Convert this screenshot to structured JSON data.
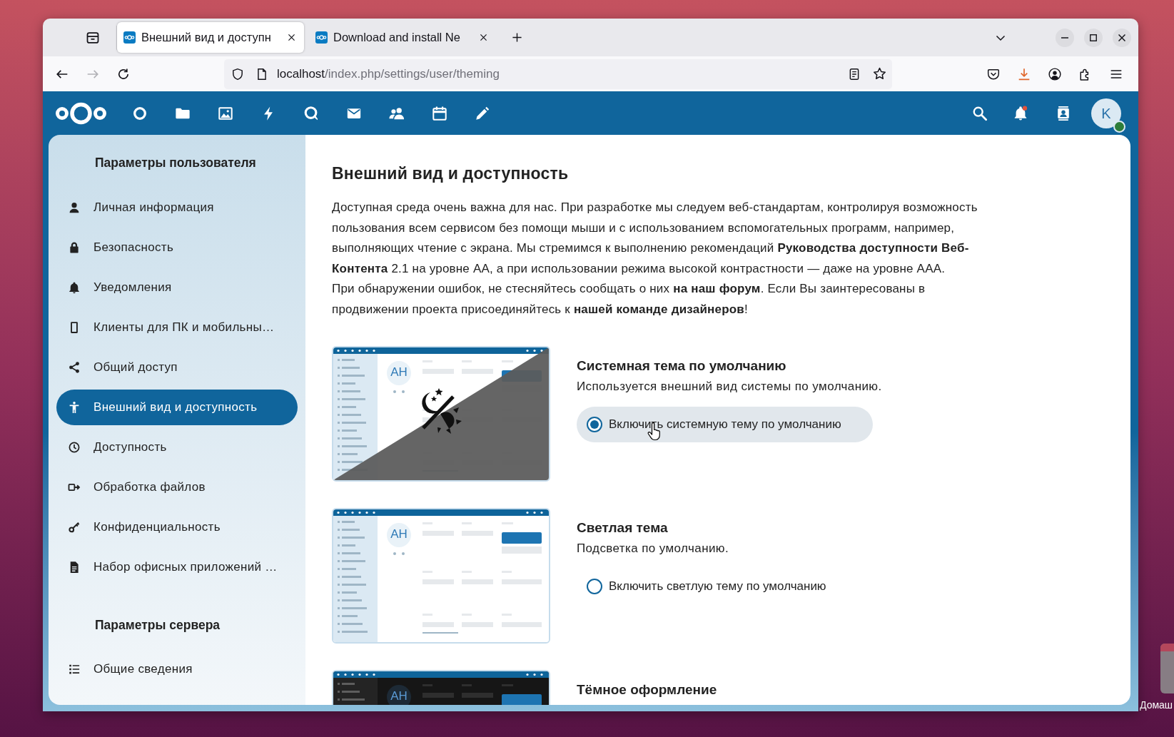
{
  "desktop": {
    "icon_label": "Домаш"
  },
  "browser": {
    "tabs": [
      {
        "title": "Внешний вид и доступн",
        "selected": true
      },
      {
        "title": "Download and install Ne",
        "selected": false
      }
    ],
    "address": {
      "host": "localhost",
      "path": "/index.php/settings/user/theming"
    },
    "forward_disabled": true
  },
  "app_header": {
    "has_notifications": true,
    "user_initial": "K",
    "online": true
  },
  "sidebar": {
    "sections": [
      {
        "heading": "Параметры пользователя",
        "items": [
          {
            "label": "Личная информация",
            "selected": false
          },
          {
            "label": "Безопасность",
            "selected": false
          },
          {
            "label": "Уведомления",
            "selected": false
          },
          {
            "label": "Клиенты для ПК и мобильны…",
            "selected": false
          },
          {
            "label": "Общий доступ",
            "selected": false
          },
          {
            "label": "Внешний вид и доступность",
            "selected": true
          },
          {
            "label": "Доступность",
            "selected": false
          },
          {
            "label": "Обработка файлов",
            "selected": false
          },
          {
            "label": "Конфиденциальность",
            "selected": false
          },
          {
            "label": "Набор офисных приложений …",
            "selected": false
          }
        ]
      },
      {
        "heading": "Параметры сервера",
        "items": [
          {
            "label": "Общие сведения",
            "selected": false
          }
        ]
      }
    ]
  },
  "content": {
    "title": "Внешний вид и доступность",
    "paragraphs": [
      "Доступная среда очень важна для нас. При разработке мы следуем веб-стандартам, контролируя возможность пользования всем сервисом без помощи мыши и с использованием вспомогательных программ, например, выполняющих чтение с экрана. Мы стремимся к выполнению рекомендаций **Руководства доступности Веб-Контента** 2.1 на уровне AA, а при использовании режима высокой контрастности — даже на уровне AAA.",
      "При обнаружении ошибок, не стесняйтесь сообщать о них **на наш форум**. Если Вы заинтересованы в продвижении проекта присоединяйтесь к **нашей команде дизайнеров**!"
    ],
    "themes": [
      {
        "kind": "system",
        "title": "Системная тема по умолчанию",
        "description": "Используется внешний вид системы по умолчанию.",
        "option": "Включить системную тему по умолчанию",
        "selected": true,
        "preview_initials": "AH"
      },
      {
        "kind": "light",
        "title": "Светлая тема",
        "description": "Подсветка по умолчанию.",
        "option": "Включить светлую тему по умолчанию",
        "selected": false,
        "preview_initials": "AH"
      },
      {
        "kind": "dark",
        "title": "Тёмное оформление",
        "preview_initials": "AH"
      }
    ]
  }
}
